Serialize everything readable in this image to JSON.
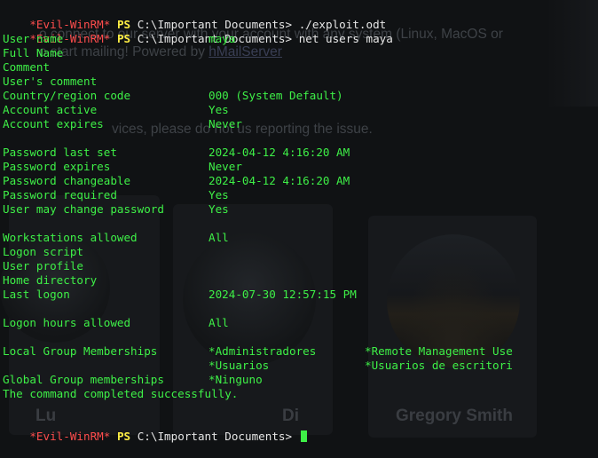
{
  "background_page": {
    "texts": [
      "o connect to our server with your account with any system (Linux, MacOS or",
      "o start mailing! Powered by",
      "hMailServer",
      "vices, please do not us reporting the issue."
    ],
    "team_names": [
      "Gregory Smith"
    ],
    "team_name_fragments": [
      "Lu",
      "Di"
    ]
  },
  "terminal": {
    "prompt": {
      "name": "*Evil-WinRM*",
      "ps": "PS",
      "path": "C:\\Important Documents>"
    },
    "commands": [
      "./exploit.odt",
      "net users maya"
    ],
    "output": [
      [
        "User name",
        "maya",
        ""
      ],
      [
        "Full Name",
        "",
        ""
      ],
      [
        "Comment",
        "",
        ""
      ],
      [
        "User's comment",
        "",
        ""
      ],
      [
        "Country/region code",
        "000 (System Default)",
        ""
      ],
      [
        "Account active",
        "Yes",
        ""
      ],
      [
        "Account expires",
        "Never",
        ""
      ],
      [
        "",
        "",
        ""
      ],
      [
        "Password last set",
        "2024-04-12 4:16:20 AM",
        ""
      ],
      [
        "Password expires",
        "Never",
        ""
      ],
      [
        "Password changeable",
        "2024-04-12 4:16:20 AM",
        ""
      ],
      [
        "Password required",
        "Yes",
        ""
      ],
      [
        "User may change password",
        "Yes",
        ""
      ],
      [
        "",
        "",
        ""
      ],
      [
        "Workstations allowed",
        "All",
        ""
      ],
      [
        "Logon script",
        "",
        ""
      ],
      [
        "User profile",
        "",
        ""
      ],
      [
        "Home directory",
        "",
        ""
      ],
      [
        "Last logon",
        "2024-07-30 12:57:15 PM",
        ""
      ],
      [
        "",
        "",
        ""
      ],
      [
        "Logon hours allowed",
        "All",
        ""
      ],
      [
        "",
        "",
        ""
      ],
      [
        "Local Group Memberships",
        "*Administradores",
        "*Remote Management Use"
      ],
      [
        "",
        "*Usuarios",
        "*Usuarios de escritori"
      ],
      [
        "Global Group memberships",
        "*Ninguno",
        ""
      ],
      [
        "The command completed successfully.",
        "",
        ""
      ],
      [
        "",
        "",
        ""
      ]
    ]
  }
}
